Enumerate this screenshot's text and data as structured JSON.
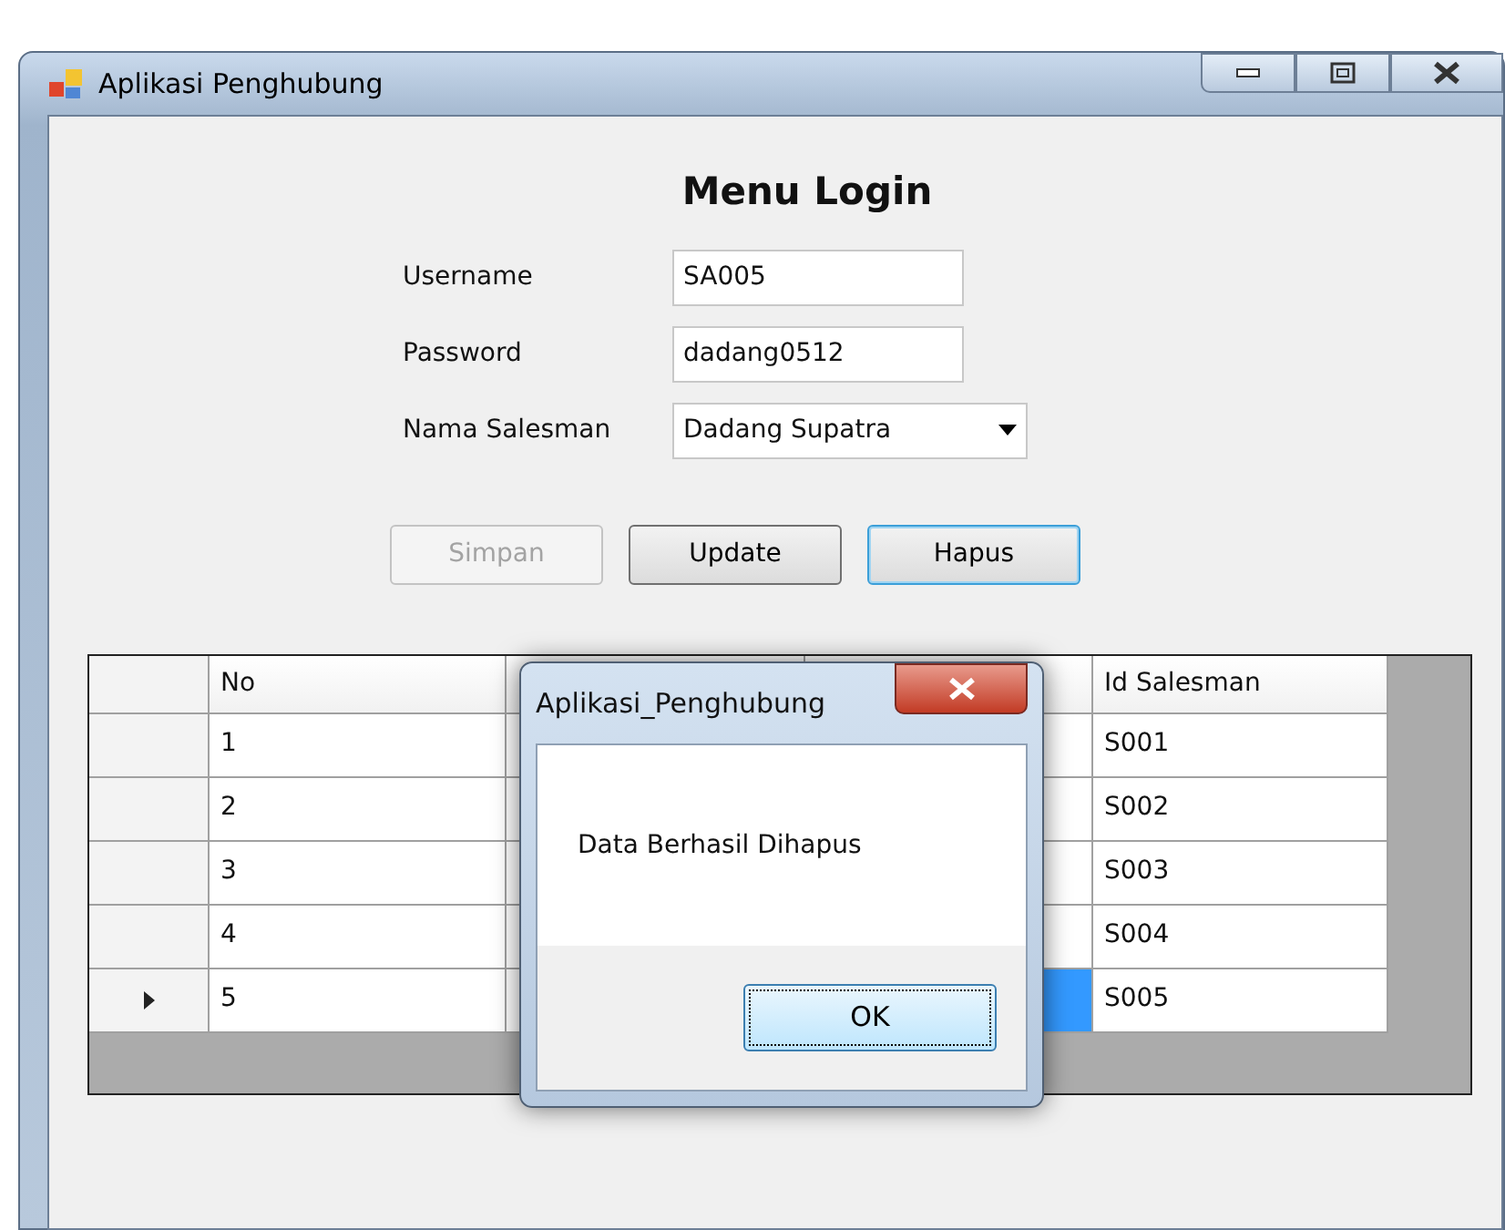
{
  "window": {
    "title": "Aplikasi Penghubung"
  },
  "heading": "Menu Login",
  "fields": [
    {
      "kind": "text",
      "label": "Username",
      "value": "SA005"
    },
    {
      "kind": "text",
      "label": "Password",
      "value": "dadang0512"
    },
    {
      "kind": "combo",
      "label": "Nama Salesman",
      "value": "Dadang Supatra"
    }
  ],
  "buttons": [
    {
      "label": "Simpan",
      "disabled": true,
      "focused": false
    },
    {
      "label": "Update",
      "disabled": false,
      "focused": false
    },
    {
      "label": "Hapus",
      "disabled": false,
      "focused": true
    }
  ],
  "table": {
    "columns": [
      "No",
      "Id Salesman"
    ],
    "rows": [
      {
        "no": "1",
        "id_salesman": "S001",
        "selected": false
      },
      {
        "no": "2",
        "id_salesman": "S002",
        "selected": false
      },
      {
        "no": "3",
        "id_salesman": "S003",
        "selected": false
      },
      {
        "no": "4",
        "id_salesman": "S004",
        "selected": false
      },
      {
        "no": "5",
        "id_salesman": "S005",
        "selected": true
      }
    ]
  },
  "dialog": {
    "title": "Aplikasi_Penghubung",
    "message": "Data Berhasil Dihapus",
    "button": "OK"
  }
}
